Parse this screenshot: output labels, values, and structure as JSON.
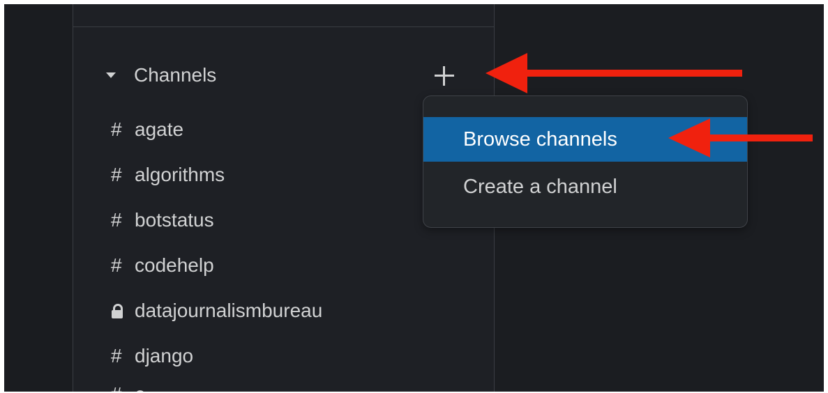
{
  "sidebar": {
    "section": {
      "title": "Channels",
      "add_button_label": "+"
    },
    "channels": [
      {
        "prefix": "#",
        "name": "agate"
      },
      {
        "prefix": "#",
        "name": "algorithms"
      },
      {
        "prefix": "#",
        "name": "botstatus"
      },
      {
        "prefix": "#",
        "name": "codehelp"
      },
      {
        "prefix": "lock-icon",
        "name": "datajournalismbureau"
      },
      {
        "prefix": "#",
        "name": "django"
      },
      {
        "prefix": "#",
        "name": "e..."
      }
    ]
  },
  "menu": {
    "items": [
      {
        "label": "Browse channels"
      },
      {
        "label": "Create a channel"
      }
    ]
  },
  "colors": {
    "highlight": "#1264a3",
    "arrow": "#f0210e",
    "background": "#1b1d21"
  }
}
